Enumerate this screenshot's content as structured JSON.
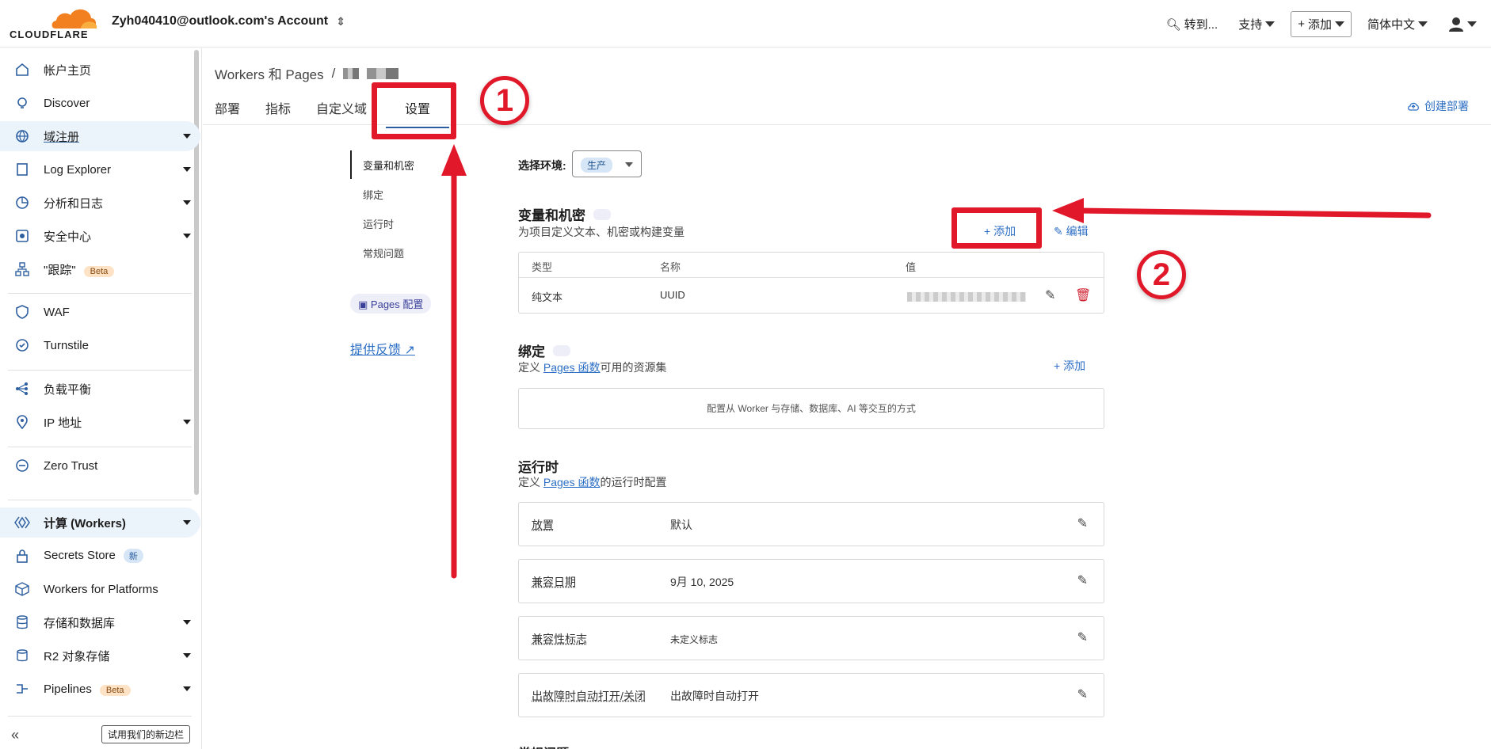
{
  "topbar": {
    "logo_text": "CLOUDFLARE",
    "account_label": "Zyh040410@outlook.com's Account",
    "goto_label": "转到...",
    "support_label": "支持",
    "add_label": "添加",
    "language_label": "简体中文"
  },
  "sidebar": {
    "items": [
      {
        "label": "帐户主页",
        "icon": "home-icon"
      },
      {
        "label": "Discover",
        "icon": "lightbulb-icon"
      },
      {
        "label": "域注册",
        "icon": "globe-icon"
      },
      {
        "label": "Log Explorer",
        "icon": "log-icon"
      },
      {
        "label": "分析和日志",
        "icon": "chart-icon"
      },
      {
        "label": "安全中心",
        "icon": "shield-icon"
      },
      {
        "label": "\"跟踪\"",
        "icon": "trace-icon",
        "badge": "Beta"
      },
      {
        "label": "WAF",
        "icon": "waf-icon"
      },
      {
        "label": "Turnstile",
        "icon": "turnstile-icon"
      },
      {
        "label": "负载平衡",
        "icon": "load-balance-icon"
      },
      {
        "label": "IP 地址",
        "icon": "location-icon"
      },
      {
        "label": "Zero Trust",
        "icon": "zero-trust-icon"
      },
      {
        "label": "计算 (Workers)",
        "icon": "workers-icon"
      },
      {
        "label": "Secrets Store",
        "icon": "lock-icon",
        "badge": "新"
      },
      {
        "label": "Workers for Platforms",
        "icon": "box-icon"
      },
      {
        "label": "存储和数据库",
        "icon": "database-icon"
      },
      {
        "label": "R2 对象存储",
        "icon": "storage-icon"
      },
      {
        "label": "Pipelines",
        "icon": "pipeline-icon",
        "badge": "Beta"
      }
    ],
    "try_new_label": "试用我们的新边栏"
  },
  "main": {
    "breadcrumb_root": "Workers 和 Pages",
    "breadcrumb_sep": "/",
    "tabs": [
      "部署",
      "指标",
      "自定义域",
      "设置"
    ],
    "create_deploy_label": "创建部署",
    "subnav": [
      "变量和机密",
      "绑定",
      "运行时",
      "常规问题"
    ],
    "pages_config_label": "Pages 配置",
    "feedback_label": "提供反馈",
    "env_label": "选择环境:",
    "env_value": "生产",
    "vars": {
      "title": "变量和机密",
      "desc": "为项目定义文本、机密或构建变量",
      "add_label": "添加",
      "edit_label": "编辑",
      "col_type": "类型",
      "col_name": "名称",
      "col_value": "值",
      "row_type": "纯文本",
      "row_name": "UUID"
    },
    "bindings": {
      "title": "绑定",
      "desc_prefix": "定义",
      "desc_link": "Pages 函数",
      "desc_suffix": "可用的资源集",
      "add_label": "添加",
      "empty_text": "配置从 Worker 与存储、数据库、AI 等交互的方式"
    },
    "runtime": {
      "title": "运行时",
      "desc_prefix": "定义",
      "desc_link": "Pages 函数",
      "desc_suffix": "的运行时配置",
      "rows": [
        {
          "key": "放置",
          "value": "默认"
        },
        {
          "key": "兼容日期",
          "value": "9月 10, 2025"
        },
        {
          "key": "兼容性标志",
          "value": "未定义标志"
        },
        {
          "key": "出故障时自动打开/关闭",
          "value": "出故障时自动打开"
        }
      ]
    },
    "general_title": "常规问题"
  },
  "annotations": {
    "step1": "1",
    "step2": "2",
    "color": "#e0182a"
  },
  "colors": {
    "accent": "#2d6fc4",
    "brand_orange": "#f38020"
  }
}
